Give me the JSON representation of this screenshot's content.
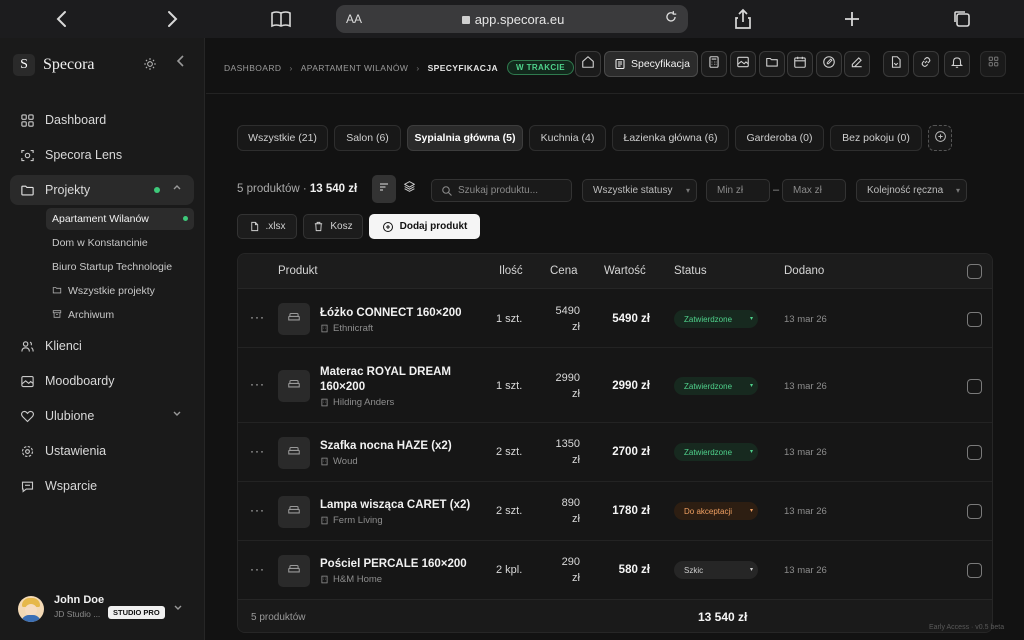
{
  "browser": {
    "aa_label": "AA",
    "url": "app.specora.eu"
  },
  "sidebar": {
    "brand": "Specora",
    "logo_letter": "S",
    "nav": [
      {
        "label": "Dashboard",
        "icon": "grid-icon"
      },
      {
        "label": "Specora Lens",
        "icon": "lens-icon"
      },
      {
        "label": "Projekty",
        "icon": "folder-icon",
        "active": true
      },
      {
        "label": "Klienci",
        "icon": "users-icon"
      },
      {
        "label": "Moodboardy",
        "icon": "image-icon"
      },
      {
        "label": "Ulubione",
        "icon": "heart-icon"
      },
      {
        "label": "Ustawienia",
        "icon": "gear-icon"
      },
      {
        "label": "Wsparcie",
        "icon": "chat-icon"
      }
    ],
    "projects": [
      {
        "label": "Apartament Wilanów",
        "active": true
      },
      {
        "label": "Dom w Konstancinie"
      },
      {
        "label": "Biuro Startup Technologie"
      },
      {
        "label": "Wszystkie projekty",
        "icon": "folder-icon"
      },
      {
        "label": "Archiwum",
        "icon": "archive-icon"
      }
    ],
    "user": {
      "name": "John Doe",
      "sub": "JD Studio ...",
      "plan": "STUDIO PRO"
    }
  },
  "header": {
    "breadcrumbs": [
      "DASHBOARD",
      "APARTAMENT WILANÓW",
      "SPECYFIKACJA"
    ],
    "separator": "›",
    "status_badge": "W TRAKCIE",
    "spec_button": "Specyfikacja"
  },
  "tabs": [
    "Wszystkie (21)",
    "Salon (6)",
    "Sypialnia główna (5)",
    "Kuchnia (4)",
    "Łazienka główna (6)",
    "Garderoba (0)",
    "Bez pokoju (0)"
  ],
  "toolbar": {
    "count_prefix": "5 produktów · ",
    "count_total": "13 540 zł",
    "search_placeholder": "Szukaj produktu...",
    "status_select": "Wszystkie statusy",
    "min_placeholder": "Min zł",
    "dash": "–",
    "max_placeholder": "Max zł",
    "order_select": "Kolejność ręczna",
    "export_label": ".xlsx",
    "trash_label": "Kosz",
    "add_label": "Dodaj produkt"
  },
  "table": {
    "headers": {
      "product": "Produkt",
      "qty": "Ilość",
      "price": "Cena",
      "value": "Wartość",
      "status": "Status",
      "added": "Dodano"
    },
    "rows": [
      {
        "name": "Łóżko CONNECT 160×200",
        "brand": "Ethnicraft",
        "qty": "1 szt.",
        "price_num": "5490",
        "price_unit": "zł",
        "value": "5490 zł",
        "status": "Zatwierdzone",
        "status_kind": "green",
        "date": "13 mar 26"
      },
      {
        "name": "Materac ROYAL DREAM 160×200",
        "brand": "Hilding Anders",
        "qty": "1 szt.",
        "price_num": "2990",
        "price_unit": "zł",
        "value": "2990 zł",
        "status": "Zatwierdzone",
        "status_kind": "green",
        "date": "13 mar 26"
      },
      {
        "name": "Szafka nocna HAZE (x2)",
        "brand": "Woud",
        "qty": "2 szt.",
        "price_num": "1350",
        "price_unit": "zł",
        "value": "2700 zł",
        "status": "Zatwierdzone",
        "status_kind": "green",
        "date": "13 mar 26"
      },
      {
        "name": "Lampa wisząca CARET (x2)",
        "brand": "Ferm Living",
        "qty": "2 szt.",
        "price_num": "890",
        "price_unit": "zł",
        "value": "1780 zł",
        "status": "Do akceptacji",
        "status_kind": "orange",
        "date": "13 mar 26"
      },
      {
        "name": "Pościel PERCALE 160×200",
        "brand": "H&M Home",
        "qty": "2 kpl.",
        "price_num": "290",
        "price_unit": "zł",
        "value": "580 zł",
        "status": "Szkic",
        "status_kind": "gray",
        "date": "13 mar 26"
      }
    ],
    "footer_count": "5 produktów",
    "footer_total": "13 540 zł"
  },
  "early_access": "Early Access · v0.5 beta",
  "colors": {
    "accent_green": "#4fd18b",
    "status_orange": "#f0a062",
    "background": "#121212"
  }
}
